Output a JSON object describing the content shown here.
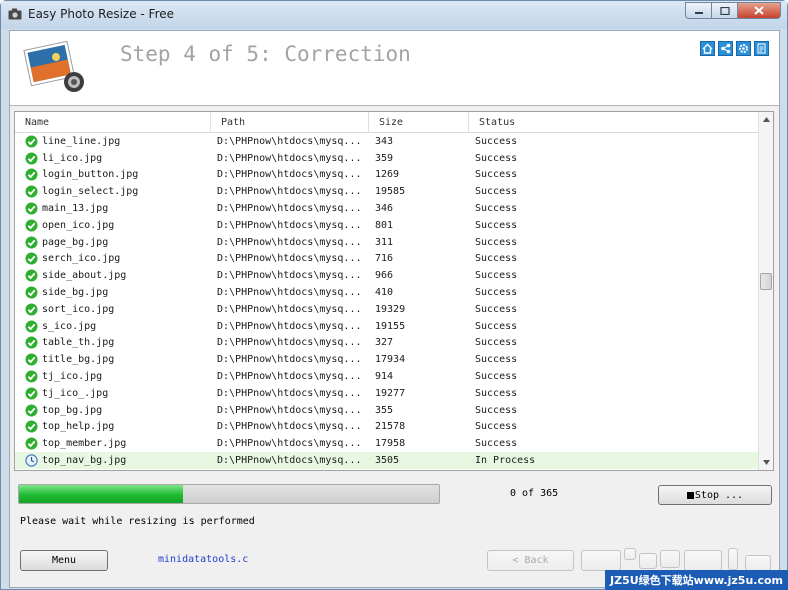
{
  "window": {
    "title": "Easy Photo Resize - Free"
  },
  "header": {
    "step_title": "Step 4 of 5: Correction"
  },
  "grid": {
    "columns": [
      "Name",
      "Path",
      "Size",
      "Status"
    ],
    "rows": [
      {
        "name": "line_line.jpg",
        "path": "D:\\PHPnow\\htdocs\\mysq...",
        "size": "343",
        "status": "Success",
        "state": "success"
      },
      {
        "name": "li_ico.jpg",
        "path": "D:\\PHPnow\\htdocs\\mysq...",
        "size": "359",
        "status": "Success",
        "state": "success"
      },
      {
        "name": "login_button.jpg",
        "path": "D:\\PHPnow\\htdocs\\mysq...",
        "size": "1269",
        "status": "Success",
        "state": "success"
      },
      {
        "name": "login_select.jpg",
        "path": "D:\\PHPnow\\htdocs\\mysq...",
        "size": "19585",
        "status": "Success",
        "state": "success"
      },
      {
        "name": "main_13.jpg",
        "path": "D:\\PHPnow\\htdocs\\mysq...",
        "size": "346",
        "status": "Success",
        "state": "success"
      },
      {
        "name": "open_ico.jpg",
        "path": "D:\\PHPnow\\htdocs\\mysq...",
        "size": "801",
        "status": "Success",
        "state": "success"
      },
      {
        "name": "page_bg.jpg",
        "path": "D:\\PHPnow\\htdocs\\mysq...",
        "size": "311",
        "status": "Success",
        "state": "success"
      },
      {
        "name": "serch_ico.jpg",
        "path": "D:\\PHPnow\\htdocs\\mysq...",
        "size": "716",
        "status": "Success",
        "state": "success"
      },
      {
        "name": "side_about.jpg",
        "path": "D:\\PHPnow\\htdocs\\mysq...",
        "size": "966",
        "status": "Success",
        "state": "success"
      },
      {
        "name": "side_bg.jpg",
        "path": "D:\\PHPnow\\htdocs\\mysq...",
        "size": "410",
        "status": "Success",
        "state": "success"
      },
      {
        "name": "sort_ico.jpg",
        "path": "D:\\PHPnow\\htdocs\\mysq...",
        "size": "19329",
        "status": "Success",
        "state": "success"
      },
      {
        "name": "s_ico.jpg",
        "path": "D:\\PHPnow\\htdocs\\mysq...",
        "size": "19155",
        "status": "Success",
        "state": "success"
      },
      {
        "name": "table_th.jpg",
        "path": "D:\\PHPnow\\htdocs\\mysq...",
        "size": "327",
        "status": "Success",
        "state": "success"
      },
      {
        "name": "title_bg.jpg",
        "path": "D:\\PHPnow\\htdocs\\mysq...",
        "size": "17934",
        "status": "Success",
        "state": "success"
      },
      {
        "name": "tj_ico.jpg",
        "path": "D:\\PHPnow\\htdocs\\mysq...",
        "size": "914",
        "status": "Success",
        "state": "success"
      },
      {
        "name": "tj_ico_.jpg",
        "path": "D:\\PHPnow\\htdocs\\mysq...",
        "size": "19277",
        "status": "Success",
        "state": "success"
      },
      {
        "name": "top_bg.jpg",
        "path": "D:\\PHPnow\\htdocs\\mysq...",
        "size": "355",
        "status": "Success",
        "state": "success"
      },
      {
        "name": "top_help.jpg",
        "path": "D:\\PHPnow\\htdocs\\mysq...",
        "size": "21578",
        "status": "Success",
        "state": "success"
      },
      {
        "name": "top_member.jpg",
        "path": "D:\\PHPnow\\htdocs\\mysq...",
        "size": "17958",
        "status": "Success",
        "state": "success"
      },
      {
        "name": "top_nav_bg.jpg",
        "path": "D:\\PHPnow\\htdocs\\mysq...",
        "size": "3505",
        "status": "In Process",
        "state": "processing"
      }
    ]
  },
  "progress": {
    "fraction": 0.39,
    "count_text": "0 of 365"
  },
  "buttons": {
    "stop": "Stop ...",
    "menu": "Menu",
    "back": "< Back"
  },
  "status_message": "Please wait while resizing is performed",
  "footer_link": "minidatatools.c",
  "watermark": "JZ5U绿色下载站www.jz5u.com",
  "colors": {
    "success": "#2fae2f",
    "progress": "#1fbb32",
    "link": "#1f3fd0",
    "accent": "#2a8fd8"
  }
}
